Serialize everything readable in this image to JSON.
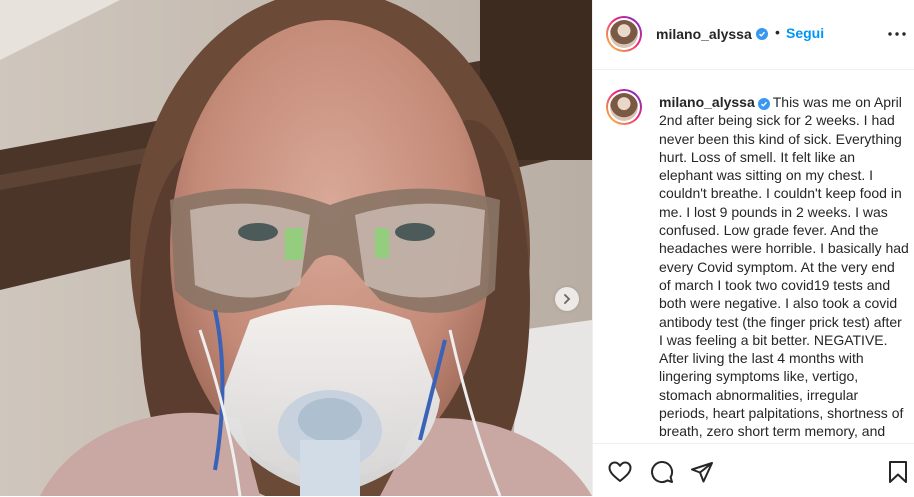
{
  "header": {
    "username": "milano_alyssa",
    "separator": "•",
    "follow_label": "Segui"
  },
  "caption": {
    "username": "milano_alyssa",
    "text": "This was me on April 2nd after being sick for 2 weeks. I had never been this kind of sick. Everything hurt. Loss of smell. It felt like an elephant was sitting on my chest. I couldn't breathe. I couldn't keep food in me. I lost 9 pounds in 2 weeks. I was confused. Low grade fever. And the headaches were horrible. I basically had every Covid symptom. At the very end of march I took two covid19 tests and both were negative. I also took a covid antibody test (the finger prick test) after I was feeling a bit better. NEGATIVE. After living the last 4 months with lingering symptoms like, vertigo, stomach abnormalities, irregular periods, heart palpitations, shortness of breath, zero short term memory, and general"
  },
  "icons": {
    "verified": "verified-badge-icon",
    "more": "more-options-icon",
    "next": "chevron-right-icon",
    "like": "heart-icon",
    "comment": "comment-icon",
    "share": "paper-plane-icon",
    "save": "bookmark-icon"
  },
  "colors": {
    "accent": "#0095f6",
    "verified": "#3897f0",
    "text": "#262626",
    "border": "#efefef"
  }
}
